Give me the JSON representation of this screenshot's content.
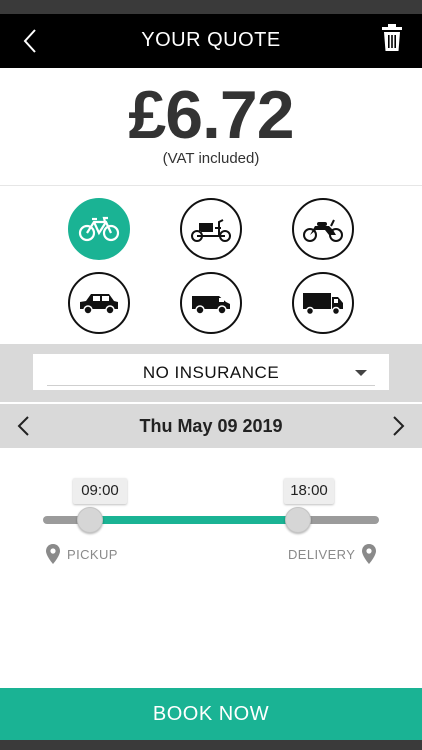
{
  "header": {
    "title": "YOUR QUOTE",
    "back_icon": "chevron-left-icon",
    "delete_icon": "trash-icon"
  },
  "quote": {
    "price": "£6.72",
    "vat_note": "(VAT included)"
  },
  "vehicles": [
    {
      "name": "bicycle-icon",
      "selected": true
    },
    {
      "name": "cargo-bike-icon",
      "selected": false
    },
    {
      "name": "motorbike-icon",
      "selected": false
    },
    {
      "name": "car-icon",
      "selected": false
    },
    {
      "name": "van-icon",
      "selected": false
    },
    {
      "name": "truck-icon",
      "selected": false
    }
  ],
  "insurance": {
    "selected": "NO INSURANCE"
  },
  "date": {
    "label": "Thu May 09 2019"
  },
  "time_window": {
    "start": "09:00",
    "end": "18:00",
    "start_fraction": 0.14,
    "end_fraction": 0.76
  },
  "locations": {
    "pickup": "PICKUP",
    "delivery": "DELIVERY"
  },
  "footer": {
    "book_label": "BOOK NOW"
  },
  "colors": {
    "accent": "#1ab394",
    "header_bg": "#000000",
    "band_bg": "#d9d9d9"
  }
}
